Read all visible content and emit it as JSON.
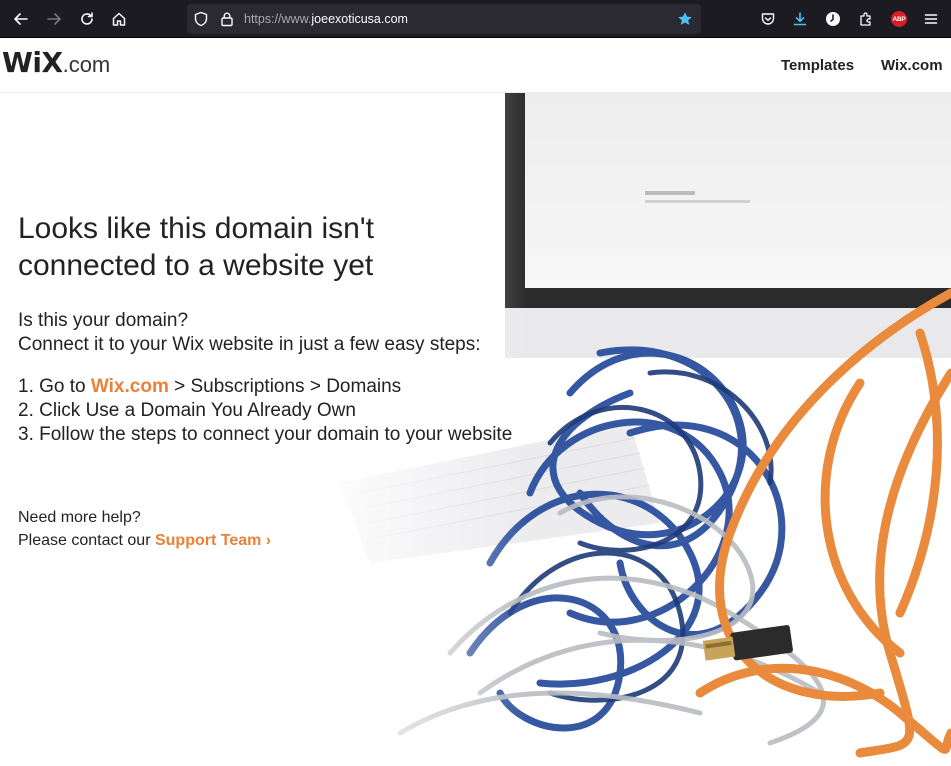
{
  "browser": {
    "url_prefix": "https://www.",
    "url_domain": "joeexoticusa.com",
    "abp_label": "ABP",
    "colors": {
      "bar": "#1c1b22",
      "urlbar": "#2b2a33",
      "bookmark_star": "#4dc3f5",
      "download": "#4dc3f5",
      "abp": "#d71f26"
    }
  },
  "header": {
    "logo_wix": "WiX",
    "logo_com": ".com",
    "nav": [
      {
        "label": "Templates"
      },
      {
        "label": "Wix.com"
      }
    ]
  },
  "main": {
    "headline_line1": "Looks like this domain isn't",
    "headline_line2": "connected to a website yet",
    "question": "Is this your domain?",
    "intro": "Connect it to your Wix website in just a few easy steps:",
    "steps": [
      {
        "prefix": "1. Go to ",
        "link": "Wix.com",
        "suffix": " > Subscriptions > Domains"
      },
      {
        "text": "2. Click Use a Domain You Already Own"
      },
      {
        "text": "3. Follow the steps to connect your domain to your website"
      }
    ],
    "help_title": "Need more help?",
    "help_prefix": "Please contact our ",
    "help_link": "Support Team",
    "help_arrow": "›",
    "accent_color": "#e8823a"
  }
}
